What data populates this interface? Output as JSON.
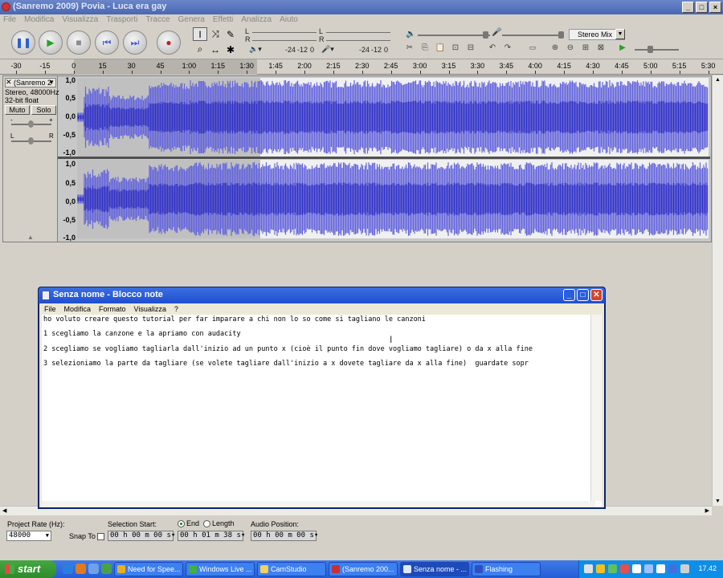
{
  "audacity": {
    "title": "(Sanremo 2009) Povia - Luca era gay",
    "menu": [
      "File",
      "Modifica",
      "Visualizza",
      "Trasporti",
      "Tracce",
      "Genera",
      "Effetti",
      "Analizza",
      "Aiuto"
    ],
    "meter_labels": [
      "L",
      "R",
      "L",
      "R"
    ],
    "meter_db": [
      "-24",
      "-12",
      "0",
      "-24",
      "-12",
      "0"
    ],
    "mixer_source": "Stereo Mix",
    "ruler_ticks": [
      "-30",
      "-15",
      "0",
      "15",
      "30",
      "45",
      "1:00",
      "1:15",
      "1:30",
      "1:45",
      "2:00",
      "2:15",
      "2:30",
      "2:45",
      "3:00",
      "3:15",
      "3:30",
      "3:45",
      "4:00",
      "4:15",
      "4:30",
      "4:45",
      "5:00",
      "5:15",
      "5:30"
    ],
    "track": {
      "name": "(Sanremo 2",
      "format": "Stereo, 48000Hz",
      "bitdepth": "32-bit float",
      "mute": "Muto",
      "solo": "Solo",
      "gain_minus": "-",
      "gain_plus": "+",
      "pan_left": "L",
      "pan_right": "R"
    },
    "scale_labels": [
      "1,0",
      "0,5",
      "0,0",
      "-0,5",
      "-1,0"
    ]
  },
  "notepad": {
    "title": "Senza nome - Blocco note",
    "menu": [
      "File",
      "Modifica",
      "Formato",
      "Visualizza",
      "?"
    ],
    "lines": [
      "ho voluto creare questo tutorial per far imparare a chi non lo so come si tagliano le canzoni",
      "1 scegliamo la canzone e la apriamo con audacity",
      "2 scegliamo se vogliamo tagliarla dall'inizio ad un punto x (cioè il punto fin dove vogliamo tagliare) o da x alla fine",
      "3 selezioniamo la parte da tagliare (se volete tagliare dall'inizio a x dovete tagliare da x alla fine)  guardate sopr"
    ]
  },
  "selection_bar": {
    "project_rate_label": "Project Rate (Hz):",
    "project_rate": "48000",
    "snap_to": "Snap To",
    "selection_start_label": "Selection Start:",
    "selection_start": "00 h 00 m 00 s",
    "end_label": "End",
    "length_label": "Length",
    "selection_end": "00 h 01 m 38 s",
    "audio_position_label": "Audio Position:",
    "audio_position": "00 h 00 m 00 s"
  },
  "taskbar": {
    "start": "start",
    "items": [
      "Need for Spee...",
      "Windows Live ...",
      "CamStudio",
      "(Sanremo 200...",
      "Senza nome - ...",
      "Flashing"
    ],
    "clock": "17.42"
  },
  "colors": {
    "waveform": "#3232c8",
    "waveform_light": "#6464dc",
    "xp_title": "#245dd8",
    "accent_close": "#d8442a"
  }
}
